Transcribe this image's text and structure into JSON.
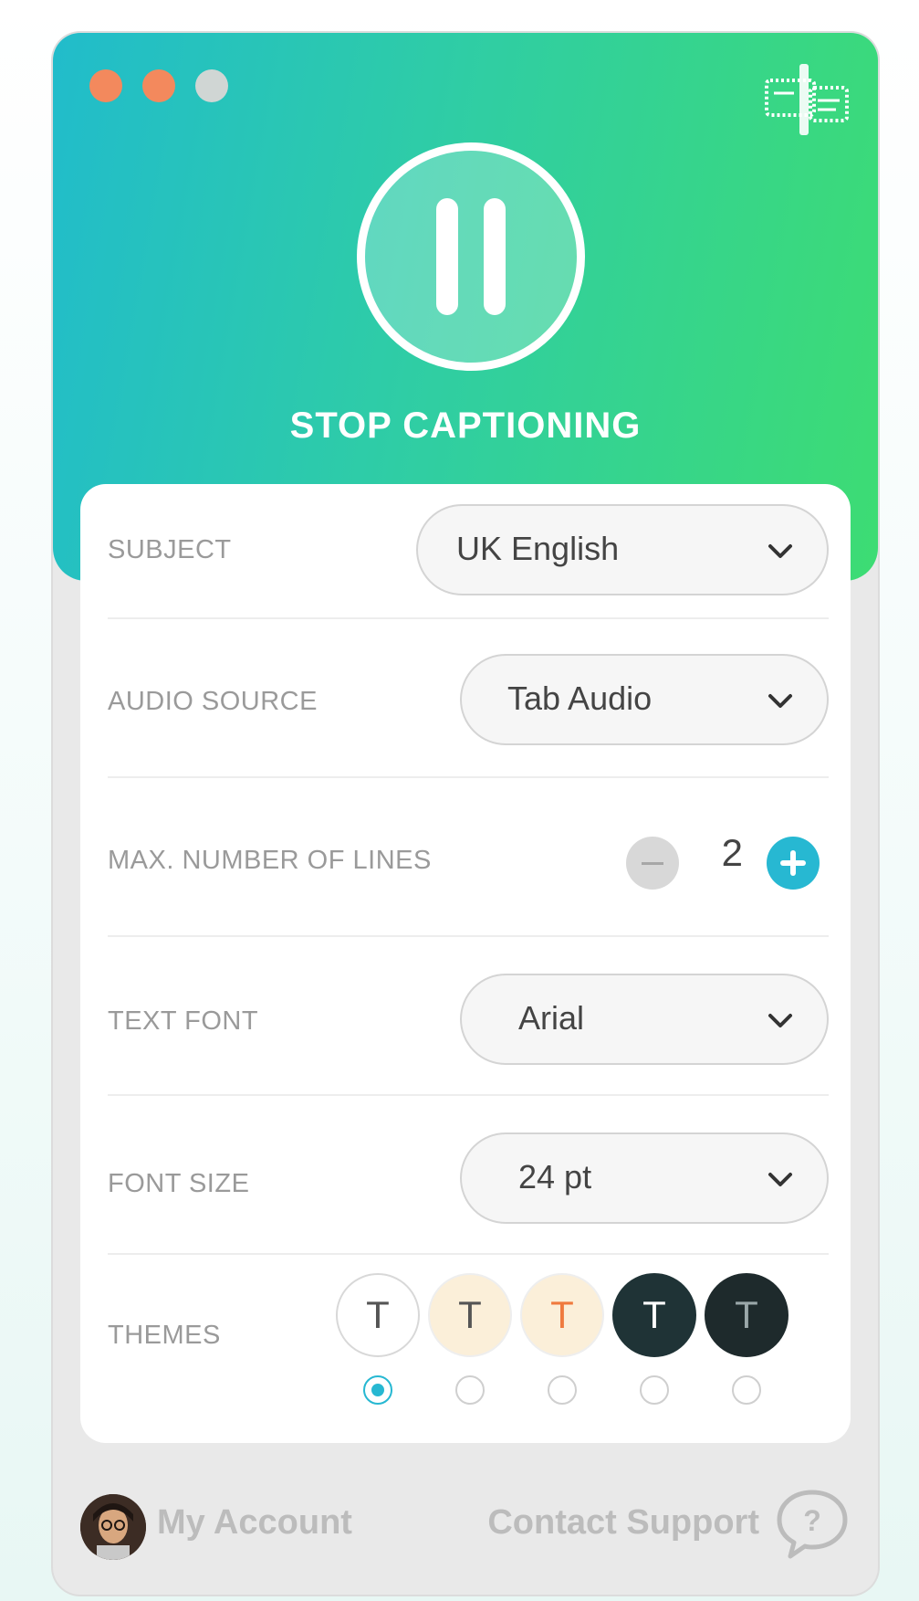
{
  "colors": {
    "header_start": "#21bccb",
    "header_end": "#3ddc73",
    "accent": "#27b8d2",
    "window_dot_1": "#f3895d",
    "window_dot_2": "#f3895d",
    "window_dot_3": "#d0d6d4"
  },
  "header": {
    "action_label": "STOP CAPTIONING",
    "action_icon": "pause-icon",
    "corner_icon": "caption-window-icon"
  },
  "settings": {
    "subject": {
      "label": "SUBJECT",
      "value": "UK English"
    },
    "audio_source": {
      "label": "AUDIO SOURCE",
      "value": "Tab Audio"
    },
    "max_lines": {
      "label": "MAX. NUMBER OF LINES",
      "value": "2"
    },
    "text_font": {
      "label": "TEXT FONT",
      "value": "Arial"
    },
    "font_size": {
      "label": "FONT SIZE",
      "value": "24 pt"
    },
    "themes": {
      "label": "THEMES",
      "selected_index": 0,
      "options": [
        {
          "glyph": "T",
          "bg": "#ffffff",
          "fg": "#555555",
          "border": "#d8d8d8"
        },
        {
          "glyph": "T",
          "bg": "#fbefd9",
          "fg": "#555555",
          "border": "#eeeeee"
        },
        {
          "glyph": "T",
          "bg": "#fbefd9",
          "fg": "#ef7a3e",
          "border": "#eeeeee"
        },
        {
          "glyph": "T",
          "bg": "#1f3336",
          "fg": "#ffffff",
          "border": "#1f3336"
        },
        {
          "glyph": "T",
          "bg": "#1e2a2c",
          "fg": "#9aa7a9",
          "border": "#1e2a2c"
        }
      ]
    }
  },
  "footer": {
    "account_label": "My Account",
    "support_label": "Contact Support"
  }
}
